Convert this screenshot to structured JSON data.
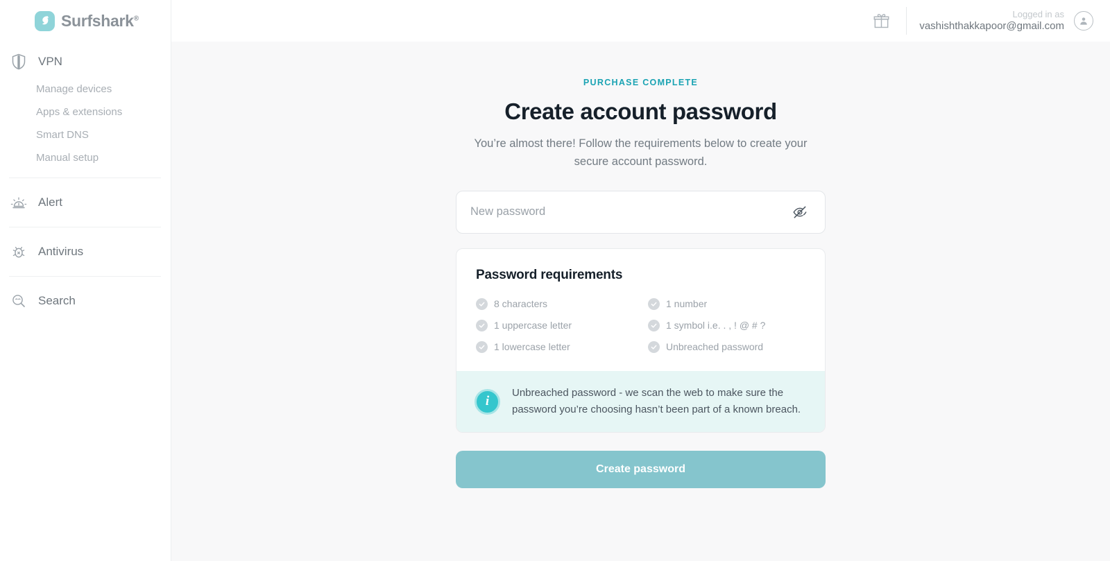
{
  "brand": {
    "name": "Surfshark",
    "registered_mark": "®",
    "logo_color": "#8fd4d9"
  },
  "sidebar": {
    "sections": [
      {
        "id": "vpn",
        "label": "VPN",
        "icon": "shield-icon",
        "items": [
          {
            "label": "Manage devices"
          },
          {
            "label": "Apps & extensions"
          },
          {
            "label": "Smart DNS"
          },
          {
            "label": "Manual setup"
          }
        ]
      },
      {
        "id": "alert",
        "label": "Alert",
        "icon": "alert-icon",
        "items": []
      },
      {
        "id": "antivirus",
        "label": "Antivirus",
        "icon": "bug-icon",
        "items": []
      },
      {
        "id": "search",
        "label": "Search",
        "icon": "search-icon",
        "items": []
      }
    ]
  },
  "topbar": {
    "gift_icon": "gift-icon",
    "logged_in_label": "Logged in as",
    "email": "vashishthakkapoor@gmail.com",
    "avatar_icon": "user-avatar-icon"
  },
  "main": {
    "eyebrow": "PURCHASE COMPLETE",
    "title": "Create account password",
    "subtitle": "You’re almost there! Follow the requirements below to create your secure account password.",
    "password_field": {
      "placeholder": "New password",
      "value": "",
      "toggle_icon": "eye-off-icon"
    },
    "requirements": {
      "title": "Password requirements",
      "left_column": [
        {
          "label": "8 characters",
          "met": false
        },
        {
          "label": "1 uppercase letter",
          "met": false
        },
        {
          "label": "1 lowercase letter",
          "met": false
        }
      ],
      "right_column": [
        {
          "label": "1 number",
          "met": false
        },
        {
          "label": "1 symbol i.e. . , ! @ # ?",
          "met": false
        },
        {
          "label": "Unbreached password",
          "met": false
        }
      ]
    },
    "info_banner": {
      "icon": "info-icon",
      "text": "Unbreached password - we scan the web to make sure the password you’re choosing hasn’t been part of a known breach.",
      "background": "#e6f6f5",
      "icon_color": "#34c6cd"
    },
    "submit_button": {
      "label": "Create password",
      "color": "#85c5cd"
    }
  },
  "colors": {
    "accent_teal": "#1aa3b3",
    "page_background": "#f8f8f9",
    "sidebar_background": "#ffffff",
    "heading": "#16202a"
  }
}
